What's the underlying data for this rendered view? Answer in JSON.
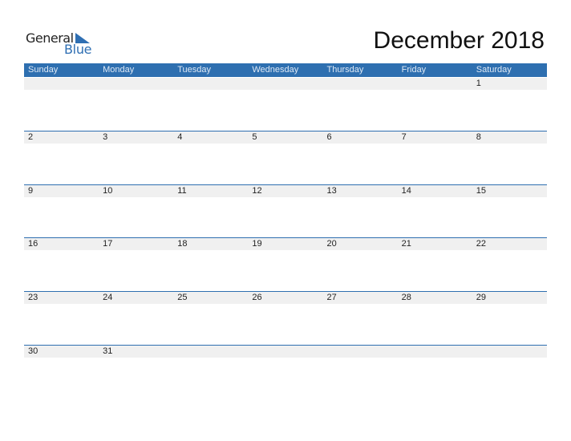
{
  "logo": {
    "line1": "General",
    "line2": "Blue"
  },
  "title": "December 2018",
  "colors": {
    "accent": "#2e6fb0",
    "strip": "#f0f0f0"
  },
  "weekdays": [
    "Sunday",
    "Monday",
    "Tuesday",
    "Wednesday",
    "Thursday",
    "Friday",
    "Saturday"
  ],
  "weeks": [
    [
      "",
      "",
      "",
      "",
      "",
      "",
      "1"
    ],
    [
      "2",
      "3",
      "4",
      "5",
      "6",
      "7",
      "8"
    ],
    [
      "9",
      "10",
      "11",
      "12",
      "13",
      "14",
      "15"
    ],
    [
      "16",
      "17",
      "18",
      "19",
      "20",
      "21",
      "22"
    ],
    [
      "23",
      "24",
      "25",
      "26",
      "27",
      "28",
      "29"
    ],
    [
      "30",
      "31",
      "",
      "",
      "",
      "",
      ""
    ]
  ]
}
